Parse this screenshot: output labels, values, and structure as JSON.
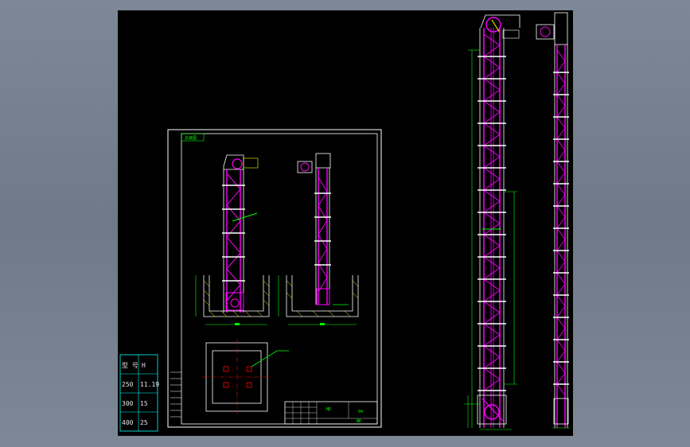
{
  "drawing": {
    "sheet_title": "总装图",
    "title_block_name": "NE",
    "title_block_code": "04",
    "title_block_stamp": "NE"
  },
  "spec_table": {
    "headers": [
      "型 号",
      "H"
    ],
    "rows": [
      [
        "250",
        "11.19"
      ],
      [
        "300",
        "15"
      ],
      [
        "400",
        "25"
      ]
    ]
  },
  "colors": {
    "background": "#000000",
    "frame": "#ffffff",
    "structure": "#ff00ff",
    "dimension": "#00ff00",
    "outline": "#ffffff",
    "centerline": "#ff0000",
    "table": "#00ffff"
  }
}
